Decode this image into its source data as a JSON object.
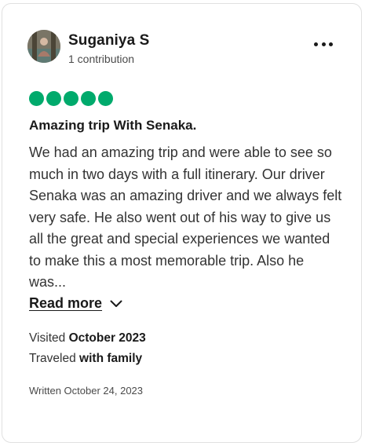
{
  "reviewer": {
    "name": "Suganiya S",
    "contributions": "1 contribution"
  },
  "rating": {
    "value": 5,
    "max": 5,
    "color": "#00aa6c"
  },
  "review": {
    "title": "Amazing trip With Senaka.",
    "text": "We had an amazing trip and were able to see so much in two days with a full itinerary. Our driver Senaka was an amazing driver and we always felt very safe. He also went out of his way to give us all the great and special experiences we wanted to make this a most memorable trip. Also he was...",
    "read_more_label": "Read more",
    "visited_label": "Visited",
    "visited_value": "October 2023",
    "traveled_label": "Traveled",
    "traveled_value": "with family",
    "written": "Written October 24, 2023"
  },
  "icons": {
    "avatar": "avatar-photo",
    "more": "more-options-icon",
    "read_more": "chevron-down-icon"
  }
}
